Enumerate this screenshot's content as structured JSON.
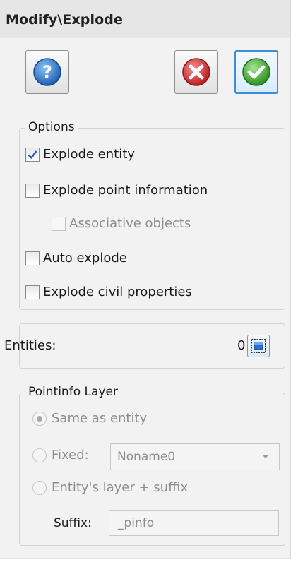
{
  "window": {
    "title": "Modify\\Explode"
  },
  "toolbar": {
    "help_icon": "help-icon",
    "cancel_icon": "cancel-icon",
    "ok_icon": "ok-check-icon",
    "colors": {
      "help": "#2f74c7",
      "cancel": "#d8393a",
      "ok": "#3fae2e"
    }
  },
  "options": {
    "legend": "Options",
    "explode_entity": {
      "label": "Explode entity",
      "checked": true
    },
    "explode_point_information": {
      "label": "Explode point information",
      "checked": false
    },
    "associative_objects": {
      "label": "Associative objects",
      "checked": false,
      "enabled": false
    },
    "auto_explode": {
      "label": "Auto explode",
      "checked": false
    },
    "explode_civil_properties": {
      "label": "Explode civil properties",
      "checked": false
    }
  },
  "entities": {
    "label": "Entities:",
    "count": "0",
    "select_icon": "select-window-icon"
  },
  "pointinfo_layer": {
    "legend": "Pointinfo Layer",
    "same_as_entity": {
      "label": "Same as entity",
      "selected": true
    },
    "fixed": {
      "label": "Fixed:",
      "selected": false,
      "value": "Noname0"
    },
    "layer_suffix": {
      "label": "Entity's layer + suffix",
      "selected": false
    },
    "suffix": {
      "label": "Suffix:",
      "value": "_pinfo"
    }
  }
}
